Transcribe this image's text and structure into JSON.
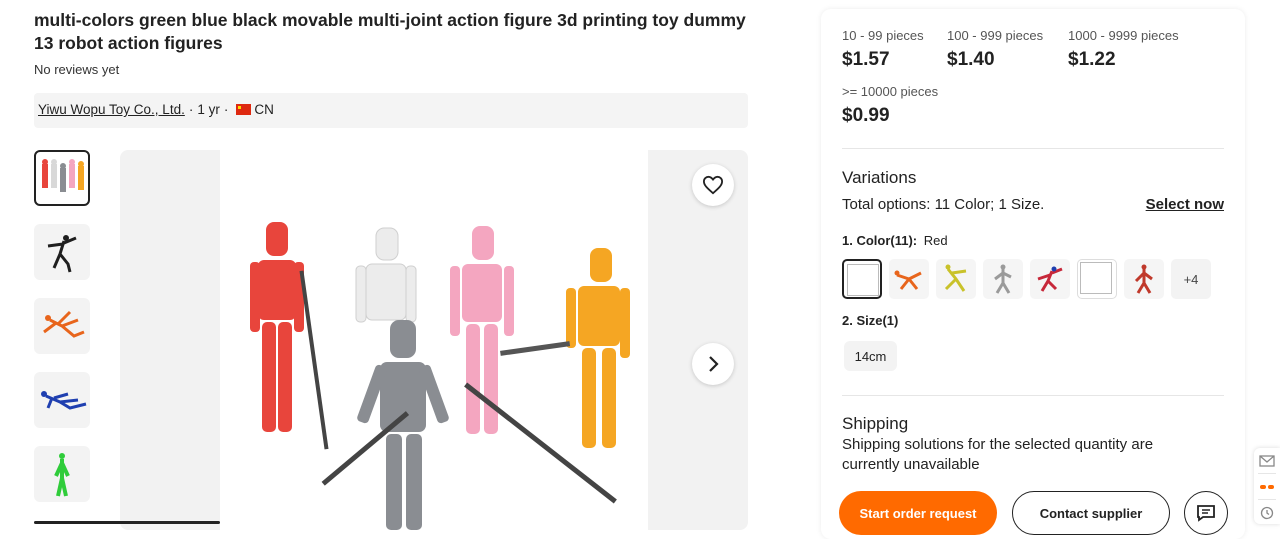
{
  "product": {
    "title": "multi-colors green blue black movable multi-joint action figure 3d printing toy dummy 13 robot action figures",
    "reviews": "No reviews yet"
  },
  "supplier": {
    "name": "Yiwu Wopu Toy Co., Ltd.",
    "years": "1 yr",
    "country": "CN",
    "separator": "·"
  },
  "gallery": {
    "thumbnails": [
      "multi-color-group",
      "black-figure-pose",
      "orange-figure-lying",
      "blue-figure-lying",
      "green-figure-standing"
    ],
    "main_image": "multi-color-figures-group",
    "colors": {
      "red": "#e8453c",
      "white": "#ececec",
      "pink": "#f4a6c0",
      "orange": "#f5a623",
      "gray": "#8a8d92",
      "black": "#1e1e1e"
    }
  },
  "pricing": {
    "tiers": [
      {
        "range": "10 - 99 pieces",
        "price": "$1.57"
      },
      {
        "range": "100 - 999 pieces",
        "price": "$1.40"
      },
      {
        "range": "1000 - 9999 pieces",
        "price": "$1.22"
      },
      {
        "range": ">= 10000 pieces",
        "price": "$0.99"
      }
    ]
  },
  "variations": {
    "title": "Variations",
    "total_prefix": "Total options:",
    "total_value": "11 Color; 1 Size.",
    "select_now": "Select now",
    "color_label": "1. Color(11):",
    "color_selected": "Red",
    "more_count": "+4",
    "size_label": "2. Size(1)",
    "size_option": "14cm"
  },
  "shipping": {
    "title": "Shipping",
    "text": "Shipping solutions for the selected quantity are currently unavailable"
  },
  "actions": {
    "start_order": "Start order request",
    "contact_supplier": "Contact supplier"
  },
  "theme": {
    "accent": "#ff6a00"
  }
}
